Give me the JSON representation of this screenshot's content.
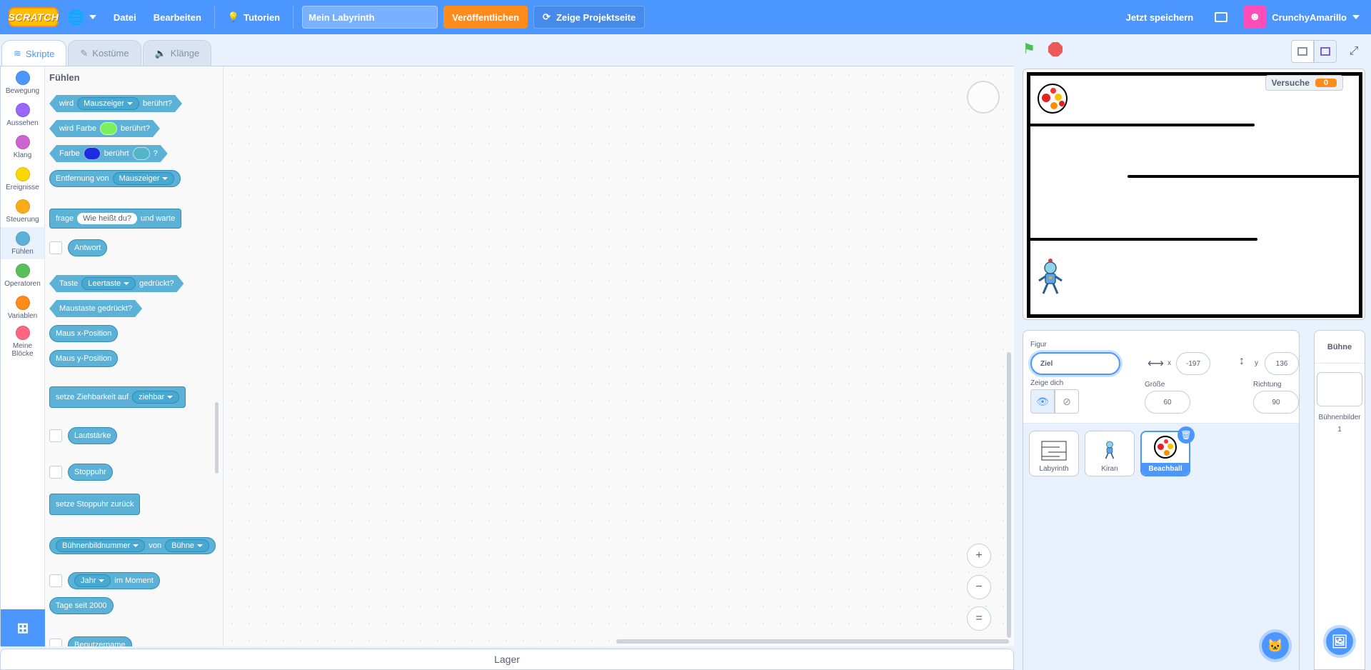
{
  "menubar": {
    "logo": "SCRATCH",
    "file": "Datei",
    "edit": "Bearbeiten",
    "tutorials": "Tutorien",
    "project_title": "Mein Labyrinth",
    "publish": "Veröffentlichen",
    "show_project_page": "Zeige Projektseite",
    "save_now": "Jetzt speichern",
    "username": "CrunchyAmarillo"
  },
  "tabs": {
    "scripts": "Skripte",
    "costumes": "Kostüme",
    "sounds": "Klänge"
  },
  "categories": [
    {
      "label": "Bewegung",
      "color": "#4c97ff"
    },
    {
      "label": "Aussehen",
      "color": "#9966ff"
    },
    {
      "label": "Klang",
      "color": "#cf63cf"
    },
    {
      "label": "Ereignisse",
      "color": "#ffd500"
    },
    {
      "label": "Steuerung",
      "color": "#ffab19"
    },
    {
      "label": "Fühlen",
      "color": "#5cb1d6"
    },
    {
      "label": "Operatoren",
      "color": "#59c059"
    },
    {
      "label": "Variablen",
      "color": "#ff8c1a"
    },
    {
      "label": "Meine Blöcke",
      "color": "#ff6680"
    }
  ],
  "palette": {
    "title": "Fühlen",
    "touching_1": "wird",
    "touching_dd": "Mauszeiger",
    "touching_2": "berührt?",
    "touch_color_1": "wird Farbe",
    "touch_color_2": "berührt?",
    "color_color_1": "Farbe",
    "color_color_2": "berührt",
    "color_color_3": "?",
    "distance_1": "Entfernung von",
    "distance_dd": "Mauszeiger",
    "ask_1": "frage",
    "ask_field": "Wie heißt du?",
    "ask_2": "und warte",
    "answer": "Antwort",
    "key_1": "Taste",
    "key_dd": "Leertaste",
    "key_2": "gedrückt?",
    "mouse_down": "Maustaste gedrückt?",
    "mouse_x": "Maus x-Position",
    "mouse_y": "Maus y-Position",
    "drag_1": "setze Ziehbarkeit auf",
    "drag_dd": "ziehbar",
    "loudness": "Lautstärke",
    "timer": "Stoppuhr",
    "reset_timer": "setze Stoppuhr zurück",
    "of_dd1": "Bühnenbildnummer",
    "of_2": "von",
    "of_dd2": "Bühne",
    "current_dd": "Jahr",
    "current_2": "im Moment",
    "days": "Tage seit 2000",
    "username_blk": "Benutzername"
  },
  "workspace": {
    "zoom_in": "+",
    "zoom_out": "−",
    "zoom_reset": "="
  },
  "backpack": "Lager",
  "stage": {
    "monitor_label": "Versuche",
    "monitor_value": "0"
  },
  "sprite_info": {
    "sprite_label": "Figur",
    "sprite_name": "Ziel",
    "x_label": "x",
    "x_value": "-197",
    "y_label": "y",
    "y_value": "136",
    "show_label": "Zeige dich",
    "size_label": "Größe",
    "size_value": "60",
    "direction_label": "Richtung",
    "direction_value": "90"
  },
  "sprites": [
    {
      "name": "Labyrinth"
    },
    {
      "name": "Kiran"
    },
    {
      "name": "Beachball",
      "selected": true
    }
  ],
  "stage_panel": {
    "title": "Bühne",
    "backdrops_label": "Bühnenbilder",
    "backdrops_count": "1"
  },
  "colors": {
    "accent": "#4c97ff",
    "sensing": "#5cb1d6",
    "orange": "#ff8c1a",
    "touch_color": "#7cf05c",
    "color_a": "#1a2ee0",
    "color_b": "#52b6c8"
  }
}
